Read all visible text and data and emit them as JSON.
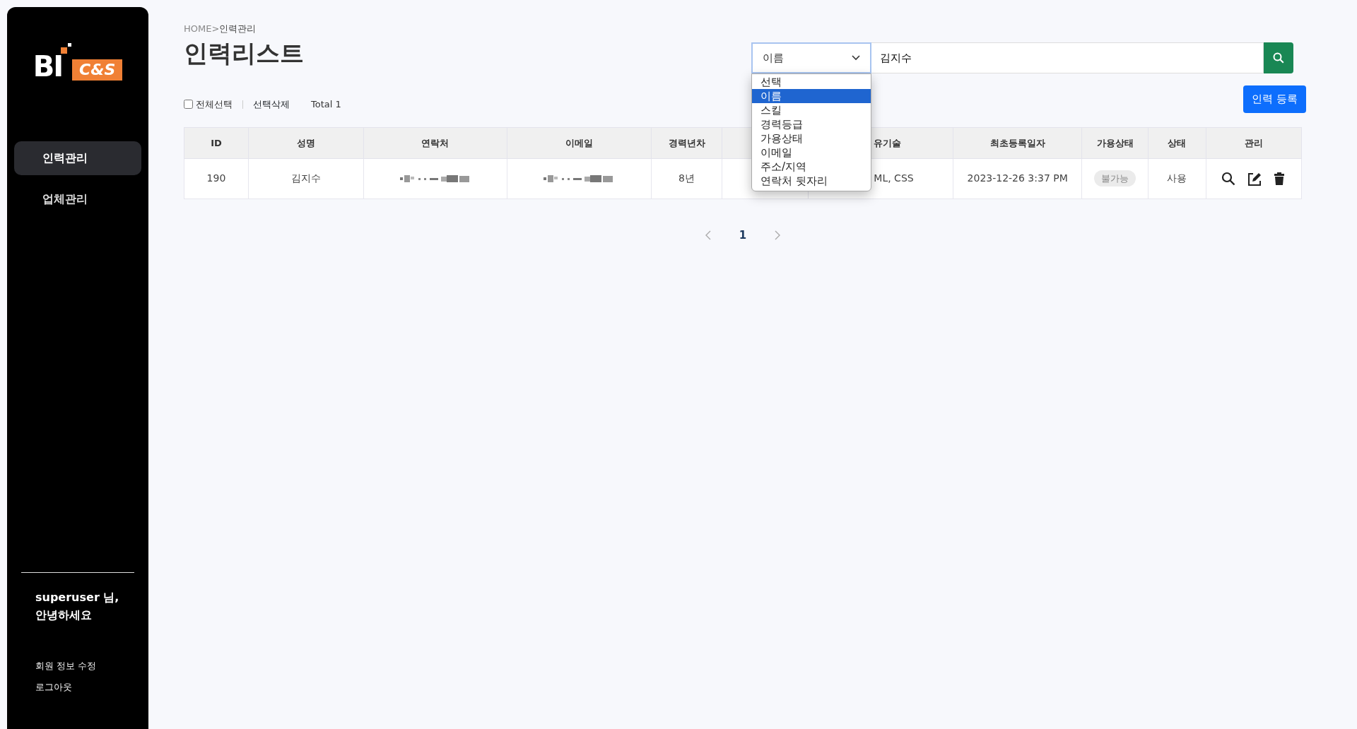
{
  "sidebar": {
    "logo": {
      "mark": "BI",
      "tag": "C&S"
    },
    "items": [
      {
        "label": "인력관리",
        "selected": true
      },
      {
        "label": "업체관리",
        "selected": false
      }
    ],
    "greeting": "superuser 님,\n안녕하세요",
    "links": [
      "회원 정보 수정",
      "로그아웃"
    ]
  },
  "breadcrumb": {
    "home": "HOME>",
    "current": "인력관리"
  },
  "title": "인력리스트",
  "search": {
    "field": "이름",
    "value": "김지수",
    "dropdown": {
      "expanded": true,
      "options": [
        {
          "label": "선택",
          "selected": false
        },
        {
          "label": "이름",
          "selected": true
        },
        {
          "label": "스킬",
          "selected": false
        },
        {
          "label": "경력등급",
          "selected": false
        },
        {
          "label": "가용상태",
          "selected": false
        },
        {
          "label": "이메일",
          "selected": false
        },
        {
          "label": "주소/지역",
          "selected": false
        },
        {
          "label": "연락처 뒷자리",
          "selected": false
        }
      ]
    }
  },
  "toolbar": {
    "select_all": {
      "label": "전체선택",
      "checked": false
    },
    "delete": "선택삭제",
    "total": "Total 1",
    "register": "인력 등록"
  },
  "table": {
    "columns": [
      {
        "kind": "text",
        "label": "ID"
      },
      {
        "kind": "text",
        "label": "성명"
      },
      {
        "kind": "text",
        "label": "연락처"
      },
      {
        "kind": "text",
        "label": "이메일"
      },
      {
        "kind": "text",
        "label": "경력년차"
      },
      {
        "kind": "covered"
      },
      {
        "kind": "partial",
        "label": "유기술"
      },
      {
        "kind": "text",
        "label": "최초등록일자"
      },
      {
        "kind": "text",
        "label": "가용상태"
      },
      {
        "kind": "text",
        "label": "상태"
      },
      {
        "kind": "text",
        "label": "관리"
      }
    ],
    "rows": [
      {
        "cells": [
          {
            "kind": "text",
            "text": "190"
          },
          {
            "kind": "text",
            "text": "김지수"
          },
          {
            "kind": "redacted"
          },
          {
            "kind": "redacted"
          },
          {
            "kind": "text",
            "text": "8년"
          },
          {
            "kind": "covered"
          },
          {
            "kind": "partial",
            "text": "ML, CSS"
          },
          {
            "kind": "text",
            "text": "2023-12-26 3:37 PM"
          },
          {
            "kind": "badge",
            "text": "불가능"
          },
          {
            "kind": "text",
            "text": "사용"
          },
          {
            "kind": "actions"
          }
        ]
      }
    ]
  },
  "pagination": {
    "pages": [
      {
        "label": "1",
        "selected": true
      }
    ]
  }
}
